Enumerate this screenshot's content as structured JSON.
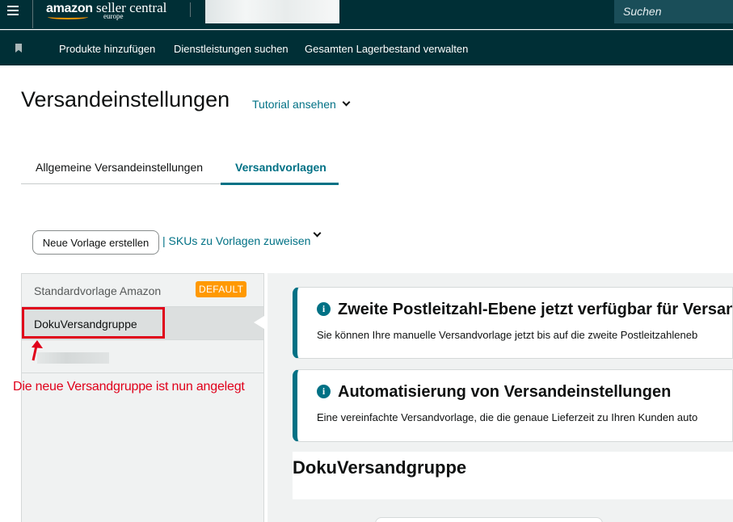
{
  "header": {
    "menu_icon": "hamburger-menu-icon",
    "logo_brand": "amazon",
    "logo_product": "seller central",
    "logo_region": "europe",
    "search_placeholder": "Suchen"
  },
  "navbar": {
    "bookmark_icon": "bookmark-icon",
    "items": [
      {
        "label": "Produkte hinzufügen"
      },
      {
        "label": "Dienstleistungen suchen"
      },
      {
        "label": "Gesamten Lagerbestand verwalten"
      }
    ]
  },
  "page": {
    "title": "Versandeinstellungen",
    "tutorial_link": "Tutorial ansehen"
  },
  "tabs": [
    {
      "label": "Allgemeine Versandeinstellungen",
      "active": false
    },
    {
      "label": "Versandvorlagen",
      "active": true
    }
  ],
  "actions": {
    "new_template": "Neue Vorlage erstellen",
    "assign_skus": "| SKUs zu Vorlagen zuweisen"
  },
  "template_list": [
    {
      "name": "Standardvorlage Amazon",
      "badge": "DEFAULT"
    },
    {
      "name": "DokuVersandgruppe",
      "selected": true
    }
  ],
  "annotation": {
    "text": "Die neue Versandgruppe ist nun angelegt",
    "color": "#e0001a"
  },
  "alerts": [
    {
      "title": "Zweite Postleitzahl-Ebene jetzt verfügbar für Versan",
      "body": "Sie können Ihre manuelle Versandvorlage jetzt bis auf die zweite Postleitzahleneb"
    },
    {
      "title": "Automatisierung von Versandeinstellungen",
      "body": "Eine vereinfachte Versandvorlage, die die genaue Lieferzeit zu Ihren Kunden auto"
    }
  ],
  "selected_group": {
    "title": "DokuVersandgruppe"
  },
  "colors": {
    "header_bg": "#002f36",
    "link": "#007185",
    "badge": "#ff9900",
    "annotation": "#e0001a"
  }
}
